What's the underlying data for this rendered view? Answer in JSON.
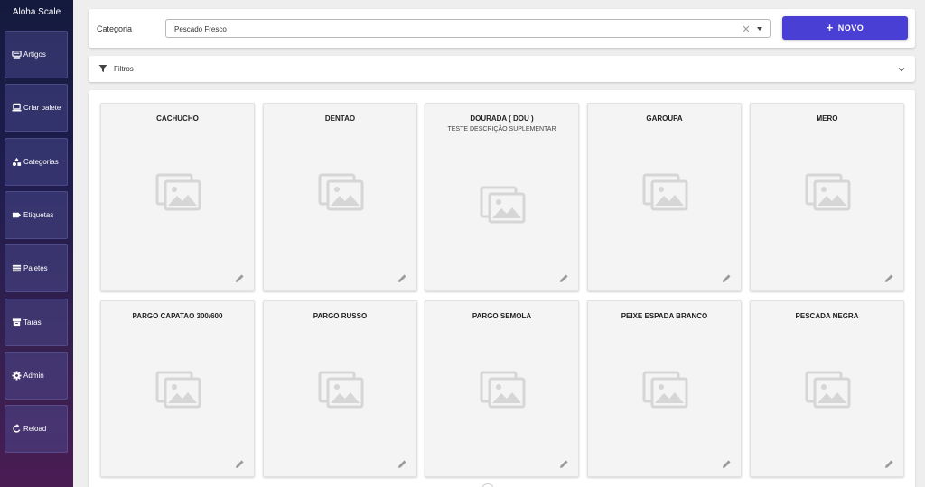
{
  "app": {
    "title": "Aloha Scale"
  },
  "sidebar": {
    "items": [
      {
        "label": "Artigos",
        "icon": "scale-icon"
      },
      {
        "label": "Criar palete",
        "icon": "computer-icon"
      },
      {
        "label": "Categorias",
        "icon": "shapes-icon"
      },
      {
        "label": "Etiquetas",
        "icon": "tag-icon"
      },
      {
        "label": "Paletes",
        "icon": "list-icon"
      },
      {
        "label": "Taras",
        "icon": "archive-icon"
      },
      {
        "label": "Admin",
        "icon": "gear-icon"
      },
      {
        "label": "Reload",
        "icon": "reload-icon"
      }
    ]
  },
  "category": {
    "label": "Categoria",
    "selected": "Pescado Fresco"
  },
  "actions": {
    "new_label": "NOVO"
  },
  "filters": {
    "label": "Filtros"
  },
  "products": [
    {
      "name": "CACHUCHO",
      "desc": ""
    },
    {
      "name": "DENTAO",
      "desc": ""
    },
    {
      "name": "DOURADA ( DOU )",
      "desc": "TESTE DESCRIÇÃO SUPLEMENTAR"
    },
    {
      "name": "GAROUPA",
      "desc": ""
    },
    {
      "name": "MERO",
      "desc": ""
    },
    {
      "name": "PARGO CAPATAO 300/600",
      "desc": ""
    },
    {
      "name": "PARGO RUSSO",
      "desc": ""
    },
    {
      "name": "PARGO SEMOLA",
      "desc": ""
    },
    {
      "name": "PEIXE ESPADA BRANCO",
      "desc": ""
    },
    {
      "name": "PESCADA NEGRA",
      "desc": ""
    }
  ],
  "colors": {
    "accent": "#4a3fd4",
    "sidebar_top": "#141a3d",
    "sidebar_bottom": "#4a1c54"
  }
}
